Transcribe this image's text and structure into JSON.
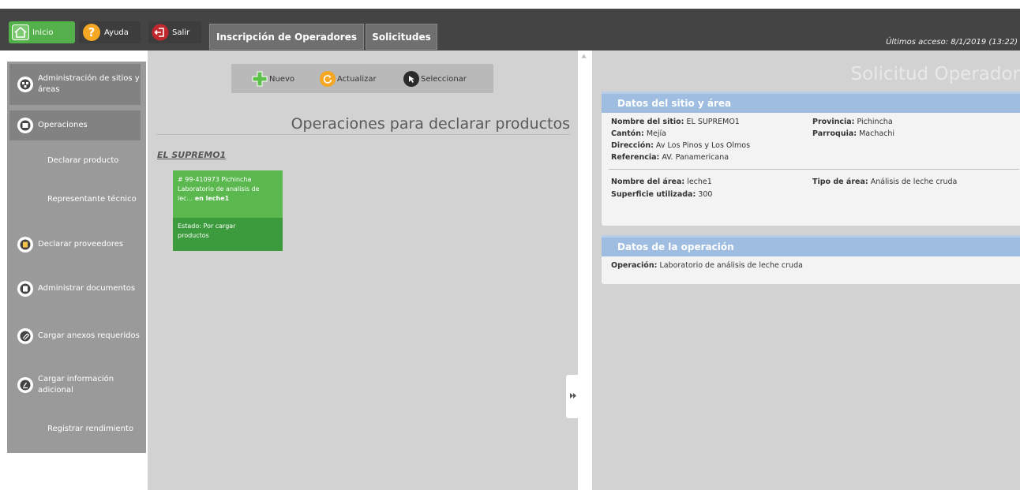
{
  "topbar": {
    "home_label": "Inicio",
    "help_label": "Ayuda",
    "exit_label": "Salir",
    "tabs": [
      "Inscripción de Operadores",
      "Solicitudes"
    ],
    "last_access": "Últimos acceso: 8/1/2019 (13:22)"
  },
  "sidebar": {
    "items": [
      {
        "label": "Administración de sitios y áreas",
        "icon": "sites-icon"
      },
      {
        "label": "Operaciones",
        "icon": "operations-icon"
      },
      {
        "label": "Declarar producto"
      },
      {
        "label": "Representante técnico"
      },
      {
        "label": "Declarar proveedores",
        "icon": "suppliers-icon"
      },
      {
        "label": "Administrar documentos",
        "icon": "documents-icon"
      },
      {
        "label": "Cargar anexos requeridos",
        "icon": "attachments-icon"
      },
      {
        "label": "Cargar información adicional",
        "icon": "info-icon"
      },
      {
        "label": "Registrar rendimiento"
      }
    ]
  },
  "toolbar": {
    "new_label": "Nuevo",
    "refresh_label": "Actualizar",
    "select_label": "Seleccionar"
  },
  "middle": {
    "title": "Operaciones para declarar productos",
    "site_name": "EL SUPREMO1",
    "card": {
      "line1": "# 99-410973 Pichincha",
      "line2": "Laboratorio de analisis de",
      "line3_prefix": "lec... ",
      "line3_bold": "en leche1",
      "status_line1": "Estado: Por cargar",
      "status_line2": "productos"
    }
  },
  "right": {
    "title": "Solicitud Operador",
    "site_panel": {
      "heading": "Datos del sitio y área",
      "site_name_label": "Nombre del sitio:",
      "site_name": "EL SUPREMO1",
      "province_label": "Provincia:",
      "province": "Pichincha",
      "canton_label": "Cantón:",
      "canton": "Mejía",
      "parish_label": "Parroquia:",
      "parish": "Machachi",
      "address_label": "Dirección:",
      "address": "Av Los Pinos y Los Olmos",
      "reference_label": "Referencia:",
      "reference": "AV. Panamericana",
      "area_name_label": "Nombre del área:",
      "area_name": "leche1",
      "area_type_label": "Tipo de área:",
      "area_type": "Análisis de leche cruda",
      "surface_label": "Superficie utilizada:",
      "surface": "300"
    },
    "operation_panel": {
      "heading": "Datos de la operación",
      "operation_label": "Operación:",
      "operation": "Laboratorio de análisis de leche cruda"
    }
  },
  "colors": {
    "topbar": "#444444",
    "home_button": "#54b04a",
    "panel_header": "#9fbde0",
    "card": "#5ab84e",
    "card_status": "#3c9b3c"
  }
}
